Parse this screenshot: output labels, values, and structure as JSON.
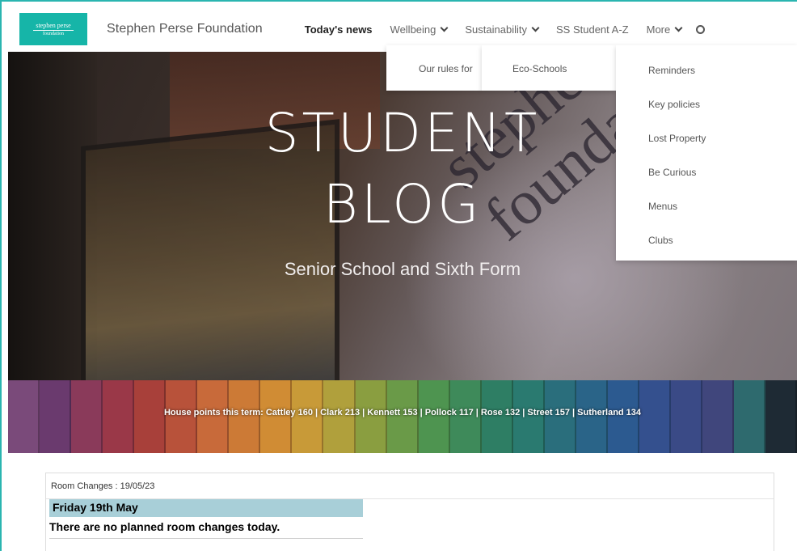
{
  "header": {
    "logo_line1": "stephen perse",
    "logo_line2": "foundation",
    "site_name": "Stephen Perse Foundation"
  },
  "nav": {
    "items": [
      {
        "label": "Today's news"
      },
      {
        "label": "Wellbeing"
      },
      {
        "label": "Sustainability"
      },
      {
        "label": "SS Student A-Z"
      },
      {
        "label": "More"
      }
    ]
  },
  "dropdowns": {
    "wellbeing": [
      "Our rules for"
    ],
    "sustainability": [
      "Eco-Schools"
    ],
    "more": [
      "Reminders",
      "Key policies",
      "Lost Property",
      "Be Curious",
      "Menus",
      "Clubs"
    ]
  },
  "hero": {
    "title_line1": "STUDENT",
    "title_line2": "BLOG",
    "subtitle": "Senior School and Sixth Form",
    "wall_text_1": "stephen perse",
    "wall_text_2": "foundation",
    "house_points": "House points this term: Cattley  160   | Clark  213    | Kennett  153  | Pollock  117  | Rose  132  | Street  157   | Sutherland  134"
  },
  "content": {
    "card_title": "Room Changes : 19/05/23",
    "day": "Friday 19th May",
    "message": "There are no planned room changes today."
  },
  "colors": {
    "accent": "#16b5a8",
    "day_row": "#a8cfd8"
  },
  "icons": [
    "chevron-down-icon",
    "search-icon"
  ]
}
